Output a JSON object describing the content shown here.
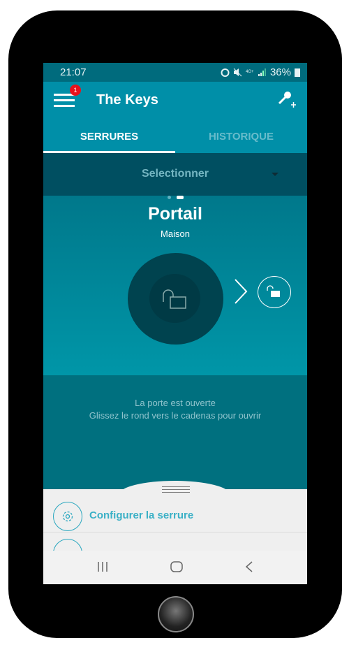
{
  "status_bar": {
    "time": "21:07",
    "battery": "36%"
  },
  "app_bar": {
    "title": "The Keys",
    "notification_count": "1",
    "menu_icon": "hamburger-icon",
    "action_icon": "key-add-icon"
  },
  "tabs": [
    {
      "label": "SERRURES",
      "active": true
    },
    {
      "label": "HISTORIQUE",
      "active": false
    }
  ],
  "selector": {
    "label": "Selectionner"
  },
  "lock": {
    "name": "Portail",
    "location": "Maison",
    "page_count": 2,
    "current_page": 2
  },
  "message": {
    "line1": "La porte est ouverte",
    "line2": "Glissez le rond vers le cadenas pour ouvrir"
  },
  "sheet": {
    "items": [
      {
        "label": "Configurer la serrure",
        "icon": "gear-icon"
      }
    ]
  },
  "colors": {
    "primary": "#008fa8",
    "dark": "#004f61",
    "accent_text": "#3ab0c6",
    "badge": "#e8121c"
  }
}
